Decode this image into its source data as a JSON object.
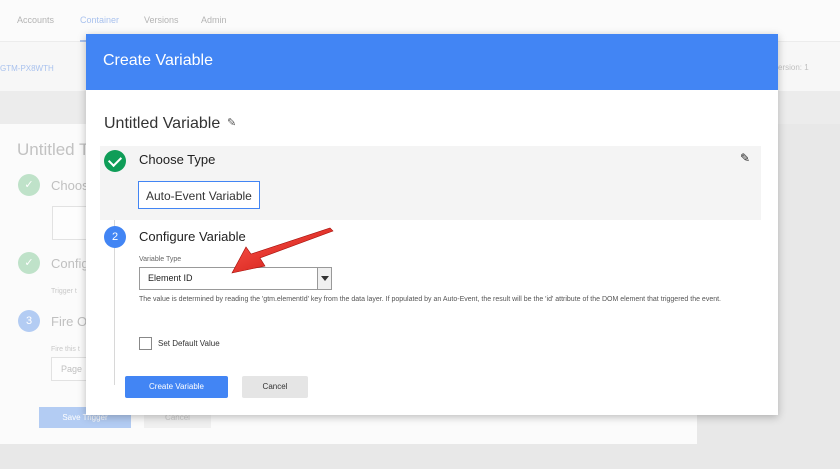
{
  "topnav": {
    "tabs": [
      {
        "label": "Accounts"
      },
      {
        "label": "Container"
      },
      {
        "label": "Versions"
      },
      {
        "label": "Admin"
      }
    ]
  },
  "subbar": {
    "container_id": "GTM-PX8WTH",
    "version": "ersion: 1"
  },
  "background": {
    "title": "Untitled T",
    "step1_label": "Choos",
    "step2_label": "Config",
    "step2_hint": "Trigger t",
    "step3_number": "3",
    "step3_label": "Fire O",
    "step3_hint": "Fire this t",
    "select_value": "Page",
    "save_label": "Save Trigger",
    "cancel_label": "Cancel"
  },
  "modal": {
    "header_title": "Create Variable",
    "variable_name": "Untitled Variable",
    "step1": {
      "label": "Choose Type",
      "type_value": "Auto-Event Variable"
    },
    "step2": {
      "number": "2",
      "label": "Configure Variable",
      "variable_type_label": "Variable Type",
      "variable_type_value": "Element ID",
      "description": "The value is determined by reading the 'gtm.elementId' key from the data layer. If populated by an Auto-Event, the result will be the 'id' attribute of the DOM element that triggered the event.",
      "default_value_label": "Set Default Value",
      "default_value_checked": false
    },
    "buttons": {
      "create": "Create Variable",
      "cancel": "Cancel"
    }
  },
  "colors": {
    "primary_blue": "#4285f4",
    "success_green": "#0f9d58",
    "annotation_red": "#e0201b"
  },
  "icons": {
    "step1_status": "check-circle-icon",
    "edit_step": "pencil-icon",
    "rename": "pencil-icon",
    "dropdown": "caret-down-icon",
    "annotation": "red-arrow-icon"
  }
}
